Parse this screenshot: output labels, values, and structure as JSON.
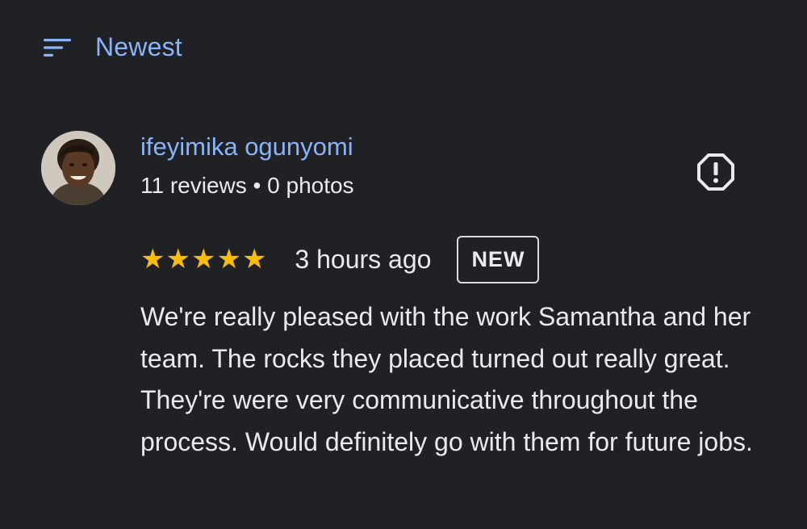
{
  "sort": {
    "icon": "sort-icon",
    "label": "Newest"
  },
  "review": {
    "avatar_icon": "reviewer-avatar",
    "reviewer_name": "ifeyimika ogunyomi",
    "reviews_count": "11 reviews",
    "separator": "•",
    "photos_count": "0 photos",
    "report_icon": "report-exclamation-icon",
    "rating": 5,
    "rating_max": 5,
    "time_ago": "3 hours ago",
    "badge": "NEW",
    "text": "We're really pleased with the work Samantha and her team. The rocks they placed turned out really great. They're were very communicative throughout the process. Would definitely go with them for future jobs."
  },
  "colors": {
    "background": "#202124",
    "accent_link": "#8ab4f8",
    "star": "#fbbc04",
    "text": "#e8eaed",
    "badge_border": "#dadce0"
  }
}
